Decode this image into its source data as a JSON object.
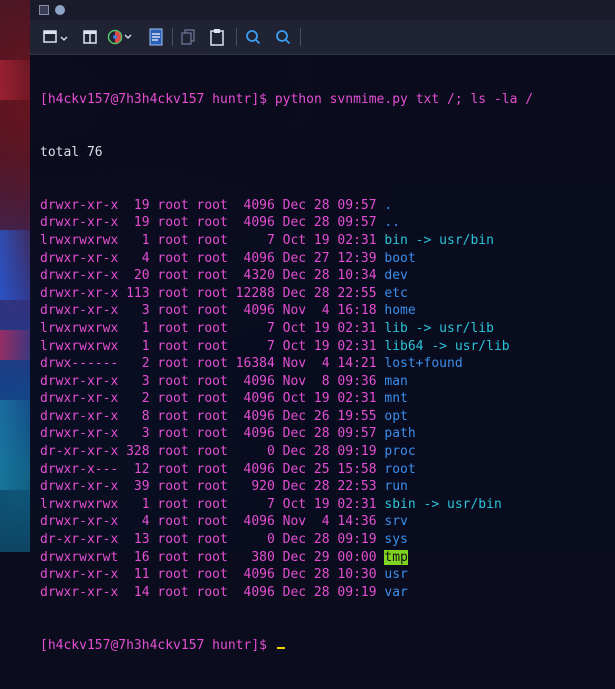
{
  "window": {
    "toolbar_icons": [
      "new-tab-icon",
      "split-view-icon",
      "color-scheme-icon",
      "document-icon",
      "copy-icon",
      "paste-icon",
      "search-icon",
      "find-icon"
    ]
  },
  "terminal": {
    "command_prompt": "[h4ckv157@7h3h4ckv157 huntr]$ ",
    "command": "python svnmime.py txt /; ls -la /",
    "total": "total 76",
    "entries": [
      {
        "meta": "drwxr-xr-x  19 root root  4096 Dec 28 09:57 ",
        "name": ".",
        "kind": "dir"
      },
      {
        "meta": "drwxr-xr-x  19 root root  4096 Dec 28 09:57 ",
        "name": "..",
        "kind": "dir"
      },
      {
        "meta": "lrwxrwxrwx   1 root root     7 Oct 19 02:31 ",
        "name": "bin -> usr/bin",
        "kind": "link"
      },
      {
        "meta": "drwxr-xr-x   4 root root  4096 Dec 27 12:39 ",
        "name": "boot",
        "kind": "dir"
      },
      {
        "meta": "drwxr-xr-x  20 root root  4320 Dec 28 10:34 ",
        "name": "dev",
        "kind": "dir"
      },
      {
        "meta": "drwxr-xr-x 113 root root 12288 Dec 28 22:55 ",
        "name": "etc",
        "kind": "dir"
      },
      {
        "meta": "drwxr-xr-x   3 root root  4096 Nov  4 16:18 ",
        "name": "home",
        "kind": "dir"
      },
      {
        "meta": "lrwxrwxrwx   1 root root     7 Oct 19 02:31 ",
        "name": "lib -> usr/lib",
        "kind": "link"
      },
      {
        "meta": "lrwxrwxrwx   1 root root     7 Oct 19 02:31 ",
        "name": "lib64 -> usr/lib",
        "kind": "link"
      },
      {
        "meta": "drwx------   2 root root 16384 Nov  4 14:21 ",
        "name": "lost+found",
        "kind": "dir"
      },
      {
        "meta": "drwxr-xr-x   3 root root  4096 Nov  8 09:36 ",
        "name": "man",
        "kind": "dir"
      },
      {
        "meta": "drwxr-xr-x   2 root root  4096 Oct 19 02:31 ",
        "name": "mnt",
        "kind": "dir"
      },
      {
        "meta": "drwxr-xr-x   8 root root  4096 Dec 26 19:55 ",
        "name": "opt",
        "kind": "dir"
      },
      {
        "meta": "drwxr-xr-x   3 root root  4096 Dec 28 09:57 ",
        "name": "path",
        "kind": "dir"
      },
      {
        "meta": "dr-xr-xr-x 328 root root     0 Dec 28 09:19 ",
        "name": "proc",
        "kind": "dir"
      },
      {
        "meta": "drwxr-x---  12 root root  4096 Dec 25 15:58 ",
        "name": "root",
        "kind": "dir"
      },
      {
        "meta": "drwxr-xr-x  39 root root   920 Dec 28 22:53 ",
        "name": "run",
        "kind": "dir"
      },
      {
        "meta": "lrwxrwxrwx   1 root root     7 Oct 19 02:31 ",
        "name": "sbin -> usr/bin",
        "kind": "link"
      },
      {
        "meta": "drwxr-xr-x   4 root root  4096 Nov  4 14:36 ",
        "name": "srv",
        "kind": "dir"
      },
      {
        "meta": "dr-xr-xr-x  13 root root     0 Dec 28 09:19 ",
        "name": "sys",
        "kind": "dir"
      },
      {
        "meta": "drwxrwxrwt  16 root root   380 Dec 29 00:00 ",
        "name": "tmp",
        "kind": "sticky"
      },
      {
        "meta": "drwxr-xr-x  11 root root  4096 Dec 28 10:30 ",
        "name": "usr",
        "kind": "dir"
      },
      {
        "meta": "drwxr-xr-x  14 root root  4096 Dec 28 09:19 ",
        "name": "var",
        "kind": "dir"
      }
    ],
    "final_prompt": "[h4ckv157@7h3h4ckv157 huntr]$ "
  },
  "colors": {
    "prompt": "#e44fd2",
    "directory": "#3b8eea",
    "symlink": "#2bc4d8",
    "sticky_bg": "#7fd320",
    "cursor": "#f4d000"
  }
}
